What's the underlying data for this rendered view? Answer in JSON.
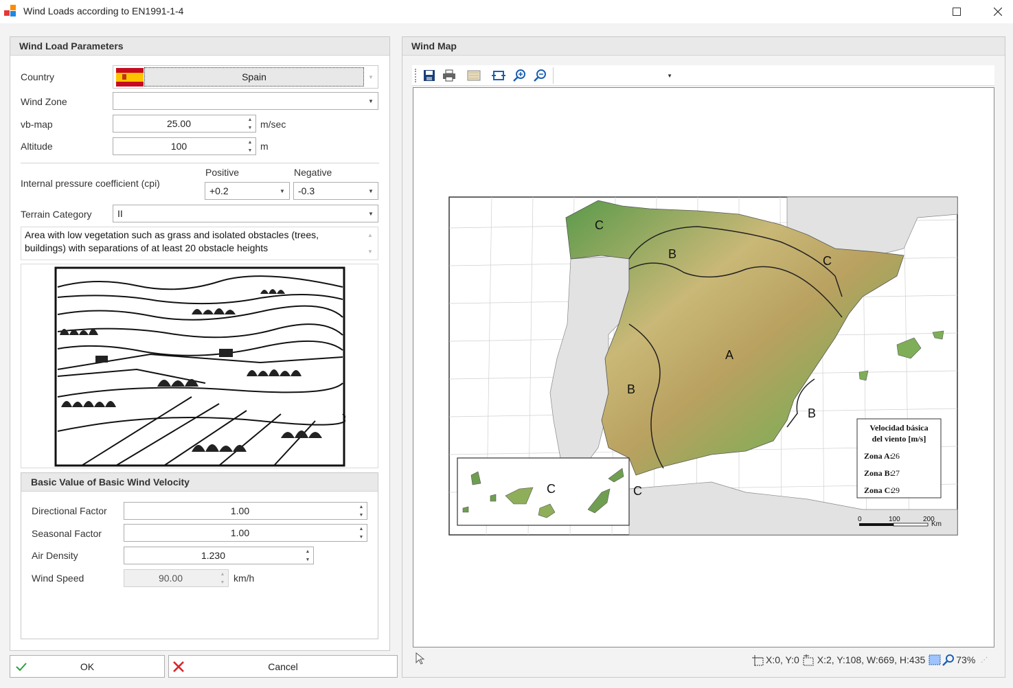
{
  "window": {
    "title": "Wind Loads according to EN1991-1-4",
    "maximize_icon": "maximize-icon",
    "close_icon": "close-icon"
  },
  "params": {
    "header": "Wind Load Parameters",
    "country_label": "Country",
    "country_value": "Spain",
    "wind_zone_label": "Wind Zone",
    "wind_zone_value": "",
    "vb_map_label": "vb-map",
    "vb_map_value": "25.00",
    "vb_map_unit": "m/sec",
    "altitude_label": "Altitude",
    "altitude_value": "100",
    "altitude_unit": "m",
    "cpi_label": "Internal pressure coefficient (cpi)",
    "positive_label": "Positive",
    "negative_label": "Negative",
    "positive_value": "+0.2",
    "negative_value": "-0.3",
    "terrain_label": "Terrain Category",
    "terrain_value": "II",
    "terrain_description": "Area with low vegetation such as grass and isolated obstacles (trees, buildings) with separations of at least 20 obstacle heights"
  },
  "basic": {
    "header": "Basic Value of Basic Wind Velocity",
    "directional_label": "Directional Factor",
    "directional_value": "1.00",
    "seasonal_label": "Seasonal Factor",
    "seasonal_value": "1.00",
    "density_label": "Air Density",
    "density_value": "1.230",
    "speed_label": "Wind Speed",
    "speed_value": "90.00",
    "speed_unit": "km/h"
  },
  "buttons": {
    "ok": "OK",
    "cancel": "Cancel"
  },
  "map": {
    "header": "Wind Map",
    "legend_title_1": "Velocidad básica",
    "legend_title_2": "del viento [m/s]",
    "legend_a_label": "Zona A:",
    "legend_a_value": "26",
    "legend_b_label": "Zona B:",
    "legend_b_value": "27",
    "legend_c_label": "Zona C:",
    "legend_c_value": "29",
    "zone_a": "A",
    "zone_b": "B",
    "zone_c": "C",
    "scale_0": "0",
    "scale_100": "100",
    "scale_200": "200",
    "scale_unit": "Km",
    "status_coords": "X:0, Y:0",
    "status_selection": "X:2, Y:108, W:669, H:435",
    "status_zoom": "73%"
  },
  "colors": {
    "flag_red": "#c60b1e",
    "flag_yellow": "#ffc400",
    "ok_green": "#2e9e3e",
    "cancel_red": "#d9262a",
    "toolbar_blue": "#1a5fb4"
  }
}
